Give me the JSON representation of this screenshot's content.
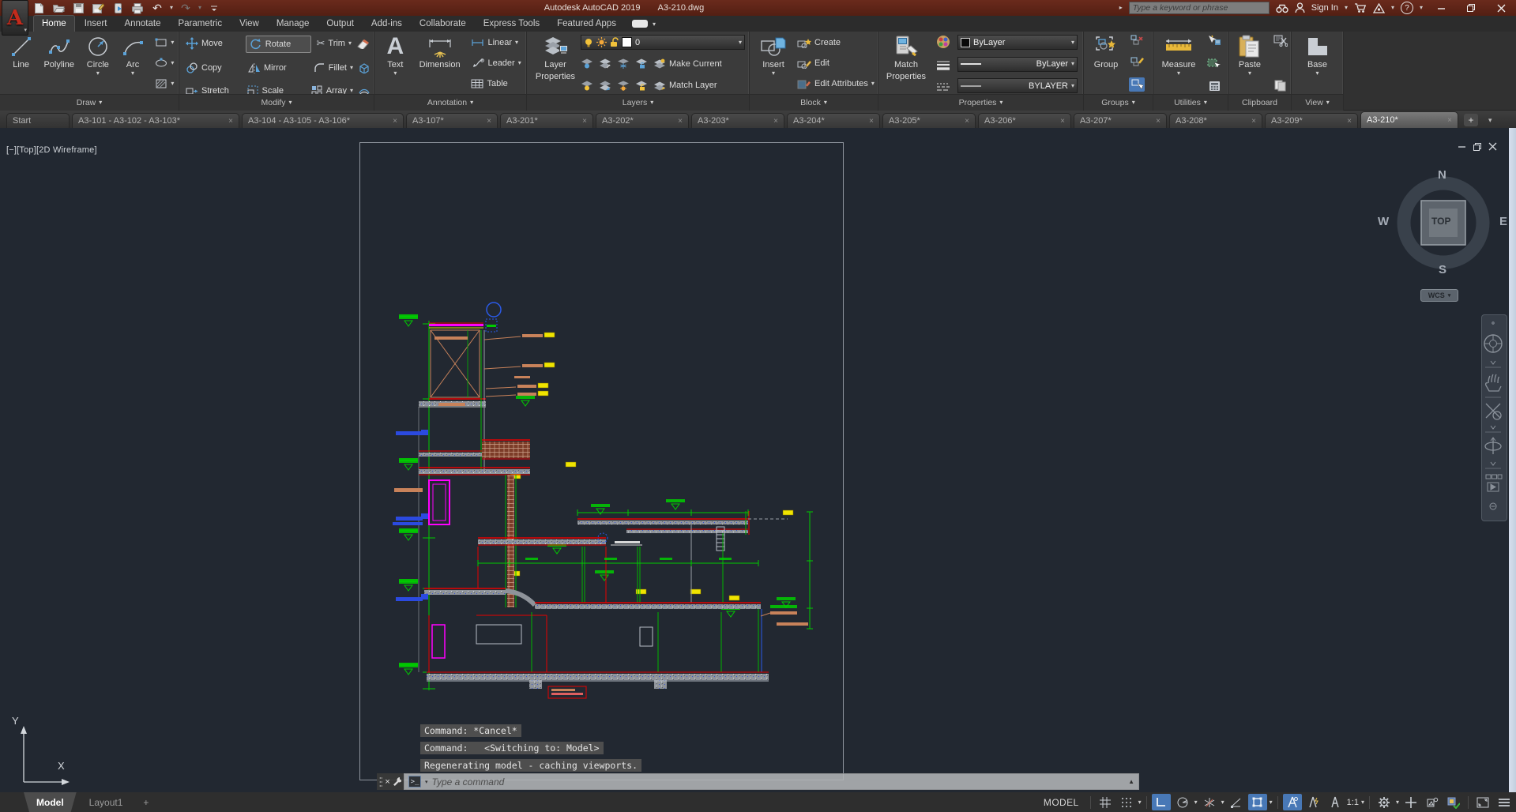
{
  "titlebar": {
    "title": "Autodesk AutoCAD 2019",
    "doc": "A3-210.dwg",
    "search_placeholder": "Type a keyword or phrase",
    "sign_in": "Sign In"
  },
  "glyphs": {
    "caret": "▾",
    "up": "▲",
    "close": "×",
    "plus": "+",
    "minus": "−",
    "scissors": "✂",
    "undo": "↶",
    "redo": "↷",
    "play": "▸",
    "question": "?",
    "prompt": ">_",
    "app_letter": "A",
    "zero": "0"
  },
  "ribbon_tabs": {
    "items": [
      {
        "label": "Home"
      },
      {
        "label": "Insert"
      },
      {
        "label": "Annotate"
      },
      {
        "label": "Parametric"
      },
      {
        "label": "View"
      },
      {
        "label": "Manage"
      },
      {
        "label": "Output"
      },
      {
        "label": "Add-ins"
      },
      {
        "label": "Collaborate"
      },
      {
        "label": "Express Tools"
      },
      {
        "label": "Featured Apps"
      }
    ]
  },
  "panels": {
    "draw": {
      "label": "Draw",
      "line": "Line",
      "polyline": "Polyline",
      "circle": "Circle",
      "arc": "Arc"
    },
    "modify": {
      "label": "Modify",
      "move": "Move",
      "rotate": "Rotate",
      "trim": "Trim",
      "copy": "Copy",
      "mirror": "Mirror",
      "fillet": "Fillet",
      "stretch": "Stretch",
      "scale": "Scale",
      "array": "Array"
    },
    "annotation": {
      "label": "Annotation",
      "text": "Text",
      "dimension": "Dimension",
      "linear": "Linear",
      "leader": "Leader",
      "table": "Table"
    },
    "layers": {
      "label": "Layers",
      "layer_properties_1": "Layer",
      "layer_properties_2": "Properties",
      "current_layer": "0",
      "make_current": "Make Current",
      "match_layer": "Match Layer"
    },
    "block": {
      "label": "Block",
      "insert": "Insert",
      "create": "Create",
      "edit": "Edit",
      "edit_attributes": "Edit Attributes"
    },
    "properties": {
      "label": "Properties",
      "match_1": "Match",
      "match_2": "Properties",
      "color": "ByLayer",
      "lineweight": "ByLayer",
      "linetype": "BYLAYER"
    },
    "groups": {
      "label": "Groups",
      "group": "Group"
    },
    "utilities": {
      "label": "Utilities",
      "measure": "Measure"
    },
    "clipboard": {
      "label": "Clipboard",
      "paste": "Paste"
    },
    "view": {
      "label": "View",
      "base": "Base"
    }
  },
  "file_tabs": {
    "start": "Start",
    "tabs": [
      "A3-101 - A3-102 - A3-103*",
      "A3-104 - A3-105 - A3-106*",
      "A3-107*",
      "A3-201*",
      "A3-202*",
      "A3-203*",
      "A3-204*",
      "A3-205*",
      "A3-206*",
      "A3-207*",
      "A3-208*",
      "A3-209*",
      "A3-210*"
    ]
  },
  "viewport": {
    "label": "[−][Top][2D Wireframe]",
    "viewcube": {
      "n": "N",
      "e": "E",
      "s": "S",
      "w": "W",
      "top": "TOP",
      "wcs": "WCS"
    },
    "ucs_x": "X",
    "ucs_y": "Y"
  },
  "command": {
    "history": [
      "Command: *Cancel*",
      "Command:   <Switching to: Model>",
      "Regenerating model - caching viewports."
    ],
    "placeholder": "Type a command"
  },
  "statusbar": {
    "model_tab": "Model",
    "layout1_tab": "Layout1",
    "new_layout": "+",
    "model_space": "MODEL",
    "annotation_scale": "1:1"
  },
  "colors": {
    "titlebar": "#5c2418",
    "ribbon": "#3b3b3b",
    "canvas": "#222831",
    "status_toggle_on": "#4878b6",
    "dim_green": "#00cc00",
    "wall_red": "#e80000",
    "frame_magenta": "#ff00ff",
    "leader_tan": "#c8825a",
    "note_yellow": "#f0e400",
    "label_blue": "#2b4ae0"
  }
}
